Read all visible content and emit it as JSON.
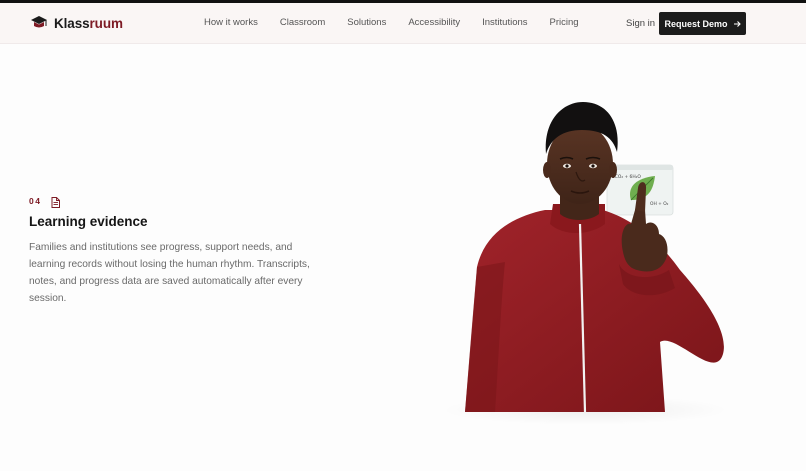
{
  "brand": {
    "name_part1": "Klass",
    "name_part2": "ruum"
  },
  "nav": {
    "items": [
      {
        "label": "How it works"
      },
      {
        "label": "Classroom"
      },
      {
        "label": "Solutions"
      },
      {
        "label": "Accessibility"
      },
      {
        "label": "Institutions"
      },
      {
        "label": "Pricing"
      }
    ]
  },
  "header": {
    "signin_label": "Sign in",
    "demo_label": "Request Demo"
  },
  "feature": {
    "step": "04",
    "title": "Learning evidence",
    "description": "Families and institutions see progress, support needs, and learning records without losing the human rhythm. Transcripts, notes, and progress data are saved automatically after every session."
  },
  "hero_card": {
    "formula_top": "6CO₂ + 6H₂O",
    "formula_bottom": "OH + O₂"
  },
  "colors": {
    "accent": "#7d1a24",
    "dark": "#1c1c1c",
    "jacket": "#8e1a1f"
  }
}
